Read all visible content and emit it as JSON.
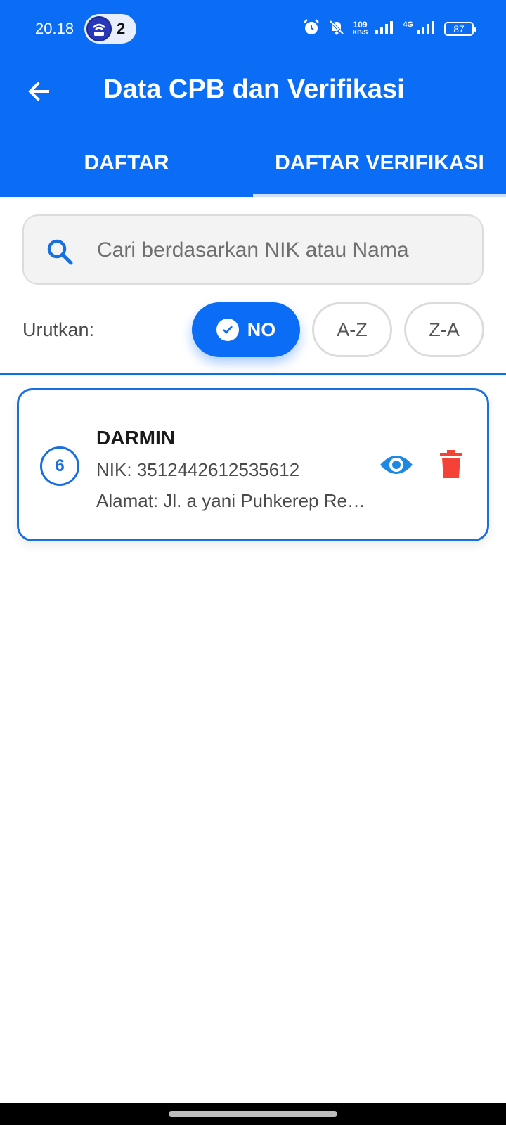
{
  "status_bar": {
    "time": "20.18",
    "notification_count": "2",
    "net_speed_value": "109",
    "net_speed_unit": "KB/S",
    "network_type": "4G",
    "battery": "87"
  },
  "app_bar": {
    "title": "Data CPB dan Verifikasi",
    "back_icon": "arrow-left-icon"
  },
  "tabs": [
    {
      "label": "DAFTAR",
      "selected": false
    },
    {
      "label": "DAFTAR VERIFIKASI",
      "selected": true
    }
  ],
  "search": {
    "placeholder": "Cari berdasarkan NIK atau Nama",
    "value": ""
  },
  "sort": {
    "label": "Urutkan:",
    "options": [
      {
        "label": "NO",
        "selected": true
      },
      {
        "label": "A-Z",
        "selected": false
      },
      {
        "label": "Z-A",
        "selected": false
      }
    ]
  },
  "list": {
    "items": [
      {
        "number": "6",
        "name": "DARMIN",
        "nik": "NIK: 3512442612535612",
        "address": "Alamat: Jl. a yani  Puhkerep  Re…"
      }
    ]
  },
  "colors": {
    "primary": "#0b6cf5",
    "card_border": "#1a6fe0",
    "view_icon": "#1e88e5",
    "delete_icon": "#f44336"
  }
}
